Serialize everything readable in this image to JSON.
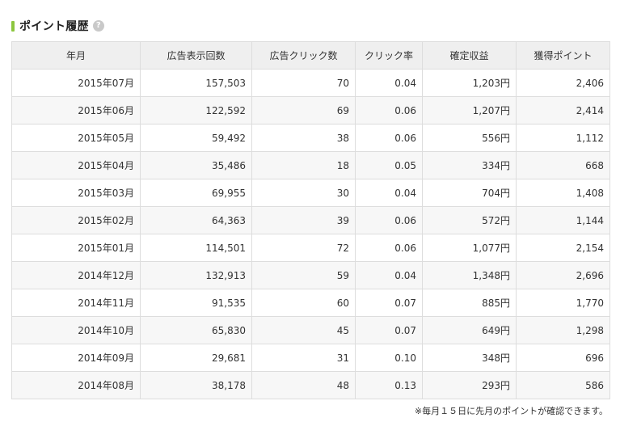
{
  "section": {
    "title": "ポイント履歴",
    "help_icon": "question-circle-icon",
    "help_glyph": "?"
  },
  "colors": {
    "accent": "#8cc63f",
    "header_bg": "#efefef",
    "row_alt_bg": "#f7f7f7",
    "border": "#dddddd"
  },
  "table": {
    "headers": [
      "年月",
      "広告表示回数",
      "広告クリック数",
      "クリック率",
      "確定収益",
      "獲得ポイント"
    ],
    "rows": [
      [
        "2015年07月",
        "157,503",
        "70",
        "0.04",
        "1,203円",
        "2,406"
      ],
      [
        "2015年06月",
        "122,592",
        "69",
        "0.06",
        "1,207円",
        "2,414"
      ],
      [
        "2015年05月",
        "59,492",
        "38",
        "0.06",
        "556円",
        "1,112"
      ],
      [
        "2015年04月",
        "35,486",
        "18",
        "0.05",
        "334円",
        "668"
      ],
      [
        "2015年03月",
        "69,955",
        "30",
        "0.04",
        "704円",
        "1,408"
      ],
      [
        "2015年02月",
        "64,363",
        "39",
        "0.06",
        "572円",
        "1,144"
      ],
      [
        "2015年01月",
        "114,501",
        "72",
        "0.06",
        "1,077円",
        "2,154"
      ],
      [
        "2014年12月",
        "132,913",
        "59",
        "0.04",
        "1,348円",
        "2,696"
      ],
      [
        "2014年11月",
        "91,535",
        "60",
        "0.07",
        "885円",
        "1,770"
      ],
      [
        "2014年10月",
        "65,830",
        "45",
        "0.07",
        "649円",
        "1,298"
      ],
      [
        "2014年09月",
        "29,681",
        "31",
        "0.10",
        "348円",
        "696"
      ],
      [
        "2014年08月",
        "38,178",
        "48",
        "0.13",
        "293円",
        "586"
      ]
    ]
  },
  "footnote": "※毎月１５日に先月のポイントが確認できます。"
}
